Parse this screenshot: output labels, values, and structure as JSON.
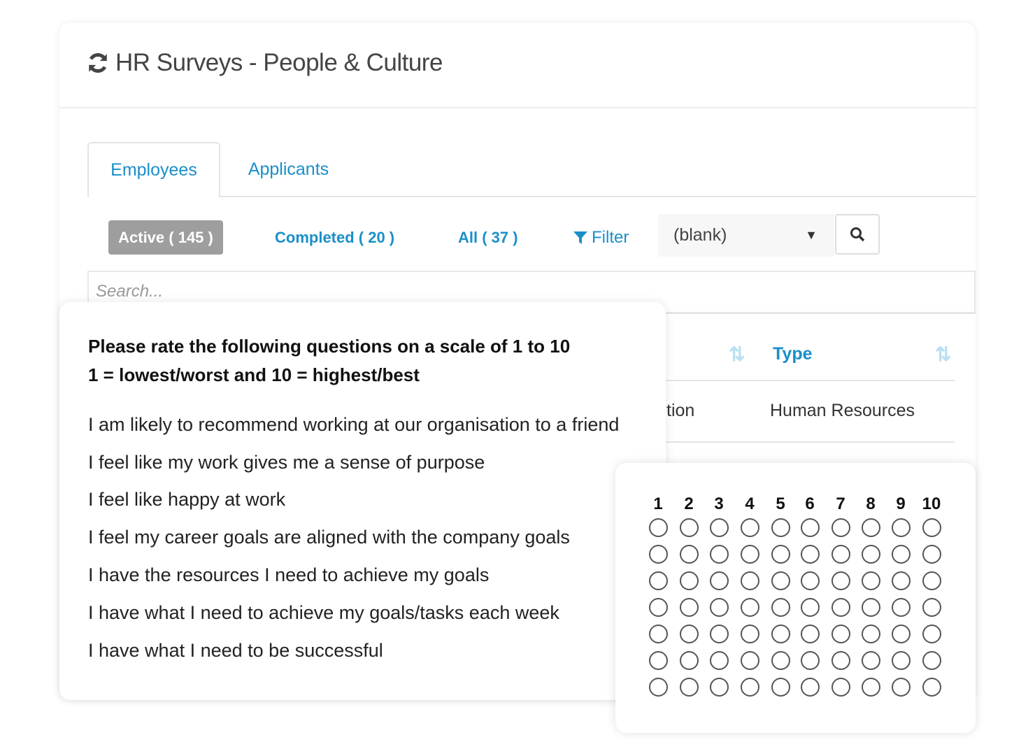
{
  "header": {
    "title": "HR Surveys - People & Culture",
    "icon": "refresh-icon"
  },
  "tabs": [
    {
      "label": "Employees",
      "active": true
    },
    {
      "label": "Applicants",
      "active": false
    }
  ],
  "filters": {
    "active": "Active ( 145 )",
    "completed": "Completed ( 20 )",
    "all": "All ( 37 )",
    "filter": "Filter",
    "select_value": "(blank)"
  },
  "search": {
    "placeholder": "Search..."
  },
  "table": {
    "headers": [
      "Type"
    ],
    "row": {
      "partial_col": "tion",
      "type": "Human Resources"
    }
  },
  "survey": {
    "heading1": "Please rate the following questions on a scale of 1 to 10",
    "heading2": "1 = lowest/worst and 10 = highest/best",
    "questions": [
      "I am likely to recommend working at our organisation to a friend",
      "I feel like my work gives me a sense of purpose",
      "I feel like happy at work",
      "I feel my career goals are aligned with the company goals",
      "I have the resources I need to achieve my goals",
      "I have what I need to achieve my goals/tasks each week",
      "I have what I need to be successful"
    ],
    "scale": [
      "1",
      "2",
      "3",
      "4",
      "5",
      "6",
      "7",
      "8",
      "9",
      "10"
    ]
  },
  "colors": {
    "accent": "#1a8fc9",
    "active_pill": "#9e9e9e"
  }
}
